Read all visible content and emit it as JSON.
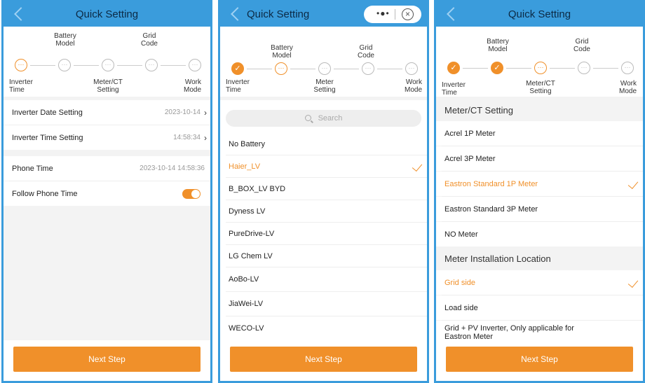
{
  "panels": [
    {
      "title": "Quick Setting",
      "steps": {
        "top": [
          "Battery\nModel",
          "Grid\nCode"
        ],
        "bottom": [
          "Inverter\nTime",
          "Meter/CT\nSetting",
          "Work\nMode"
        ],
        "icons": [
          "···",
          "···",
          "···",
          "···",
          "···"
        ]
      },
      "rows": [
        {
          "label": "Inverter Date Setting",
          "value": "2023-10-14"
        },
        {
          "label": "Inverter Time Setting",
          "value": "14:58:34"
        },
        {
          "label": "Phone Time",
          "value": "2023-10-14 14:58:36"
        },
        {
          "label": "Follow Phone Time",
          "toggle": true
        }
      ],
      "next": "Next Step"
    },
    {
      "title": "Quick Setting",
      "capsule": {
        "menu": "•●•",
        "close": "×"
      },
      "steps": {
        "top": [
          "Battery\nModel",
          "Grid\nCode"
        ],
        "bottom": [
          "Inverter\nTime",
          "Meter\nSetting",
          "Work\nMode"
        ],
        "icons": [
          "✓",
          "···",
          "···",
          "···",
          "···"
        ]
      },
      "search_placeholder": "Search",
      "items": [
        "No Battery",
        "Haier_LV",
        "B_BOX_LV BYD",
        "Dyness LV",
        "PureDrive-LV",
        "LG Chem LV",
        "AoBo-LV",
        "JiaWei-LV",
        "WECO-LV"
      ],
      "selected": "Haier_LV",
      "next": "Next Step"
    },
    {
      "title": "Quick Setting",
      "steps": {
        "top": [
          "Battery\nModel",
          "Grid\nCode"
        ],
        "bottom": [
          "Inverter\nTime",
          "Meter/CT\nSetting",
          "Work\nMode"
        ],
        "icons": [
          "✓",
          "✓",
          "···",
          "···",
          "···"
        ]
      },
      "section1": "Meter/CT Setting",
      "meters": [
        "Acrel 1P Meter",
        "Acrel 3P Meter",
        "Eastron Standard 1P Meter",
        "Eastron Standard 3P Meter",
        "NO Meter"
      ],
      "meter_selected": "Eastron Standard 1P Meter",
      "section2": "Meter Installation Location",
      "locations": [
        "Grid side",
        "Load side",
        "Grid + PV Inverter, Only applicable for Eastron Meter"
      ],
      "location_selected": "Grid side",
      "next": "Next Step"
    }
  ],
  "colors": {
    "header": "#3a9cdc",
    "accent": "#f0902a",
    "background": "#f3f3f3"
  }
}
